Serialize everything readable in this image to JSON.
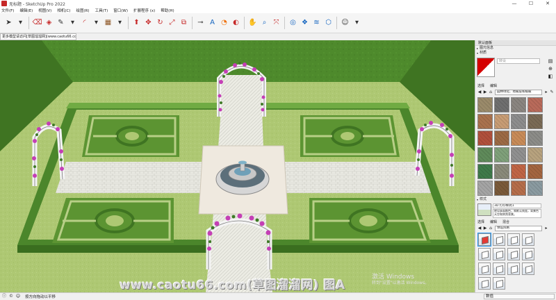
{
  "titlebar": {
    "title": "无标题 - SketchUp Pro 2022",
    "minimize": "—",
    "maximize": "☐",
    "close": "✕"
  },
  "menu": {
    "items": [
      "文件(F)",
      "编辑(E)",
      "视图(V)",
      "相机(C)",
      "绘图(R)",
      "工具(T)",
      "窗口(W)",
      "扩展程序 (x)",
      "帮助(H)"
    ]
  },
  "toolbar": {
    "icons": [
      {
        "name": "select-icon",
        "glyph": "➤",
        "color": "c-dark"
      },
      {
        "name": "dropdown-icon",
        "glyph": "▾",
        "color": "c-dark"
      },
      {
        "name": "eraser-icon",
        "glyph": "⌫",
        "color": "c-red"
      },
      {
        "name": "paint-bucket-icon",
        "glyph": "◈",
        "color": "c-red"
      },
      {
        "name": "line-icon",
        "glyph": "✎",
        "color": "c-dark"
      },
      {
        "name": "dropdown-icon",
        "glyph": "▾",
        "color": "c-dark"
      },
      {
        "name": "arc-icon",
        "glyph": "◜",
        "color": "c-red"
      },
      {
        "name": "dropdown-icon",
        "glyph": "▾",
        "color": "c-dark"
      },
      {
        "name": "rectangle-icon",
        "glyph": "▦",
        "color": "c-brown"
      },
      {
        "name": "dropdown-icon",
        "glyph": "▾",
        "color": "c-dark"
      },
      {
        "name": "push-pull-icon",
        "glyph": "⬆",
        "color": "c-red"
      },
      {
        "name": "move-icon",
        "glyph": "✥",
        "color": "c-red"
      },
      {
        "name": "rotate-icon",
        "glyph": "↻",
        "color": "c-red"
      },
      {
        "name": "scale-icon",
        "glyph": "⤢",
        "color": "c-red"
      },
      {
        "name": "offset-icon",
        "glyph": "⧉",
        "color": "c-red"
      },
      {
        "name": "tape-measure-icon",
        "glyph": "⊸",
        "color": "c-dark"
      },
      {
        "name": "text-icon",
        "glyph": "A",
        "color": "c-blue"
      },
      {
        "name": "protractor-icon",
        "glyph": "◔",
        "color": "c-orange"
      },
      {
        "name": "orbit-icon",
        "glyph": "◐",
        "color": "c-red"
      },
      {
        "name": "pan-icon",
        "glyph": "✋",
        "color": "c-dark"
      },
      {
        "name": "zoom-icon",
        "glyph": "⌕",
        "color": "c-blue"
      },
      {
        "name": "zoom-extents-icon",
        "glyph": "⤧",
        "color": "c-red"
      },
      {
        "name": "warehouse-icon",
        "glyph": "◎",
        "color": "c-blue"
      },
      {
        "name": "extension-warehouse-icon",
        "glyph": "❖",
        "color": "c-blue"
      },
      {
        "name": "layout-icon",
        "glyph": "≋",
        "color": "c-blue"
      },
      {
        "name": "component-icon",
        "glyph": "⬡",
        "color": "c-blue"
      },
      {
        "name": "account-icon",
        "glyph": "☺",
        "color": "c-dark"
      },
      {
        "name": "dropdown-icon",
        "glyph": "▾",
        "color": "c-dark"
      }
    ]
  },
  "urlstrip": "更多模型请访问[草图溜溜网](www.caotu66.com)",
  "viewport": {
    "watermark": "www.caotu66.com(草图溜溜网) 图A",
    "activate_line1": "激活 Windows",
    "activate_line2": "转到\"设置\"以激活 Windows。"
  },
  "panel": {
    "title": "默认面板",
    "tray_shadow": "图元信息",
    "tray_materials": "材质",
    "material_name_placeholder": "转设",
    "tab_select": "选择",
    "tab_edit": "编辑",
    "material_library": "园林绿化、地被层和植被",
    "styles_header": "样式",
    "style_name": "3D 打印样式1",
    "style_desc": "转设表面颜色，和默认线宽，背景色天空和突然背景。",
    "style_tab_select": "选择",
    "style_tab_edit": "编辑",
    "style_tab_mix": "混合",
    "style_library": "预设风格"
  },
  "textures": [
    "#9a8a6a",
    "#6f6f6f",
    "#8a8580",
    "#b86a5a",
    "#a9724e",
    "#c79c74",
    "#8d8d8d",
    "#7a6a55",
    "#b0503c",
    "#9c6a45",
    "#c88b58",
    "#8c8c88",
    "#5f8a5a",
    "#7fa07a",
    "#909090",
    "#b7a27e",
    "#3f7a4a",
    "#8a8a7a",
    "#c06545",
    "#a36540",
    "#a4a4a4",
    "#7a5a3a",
    "#b56d4a",
    "#8a9aa0"
  ],
  "statusbar": {
    "hint": "按方向拖动以平移",
    "measure_label": "数值"
  },
  "colors": {
    "hedge": "#4f8a2e",
    "hedge_top": "#6aa33d",
    "lawn": "#a9c56d",
    "paving": "#e8e8e0",
    "accent_red": "#d50000"
  }
}
